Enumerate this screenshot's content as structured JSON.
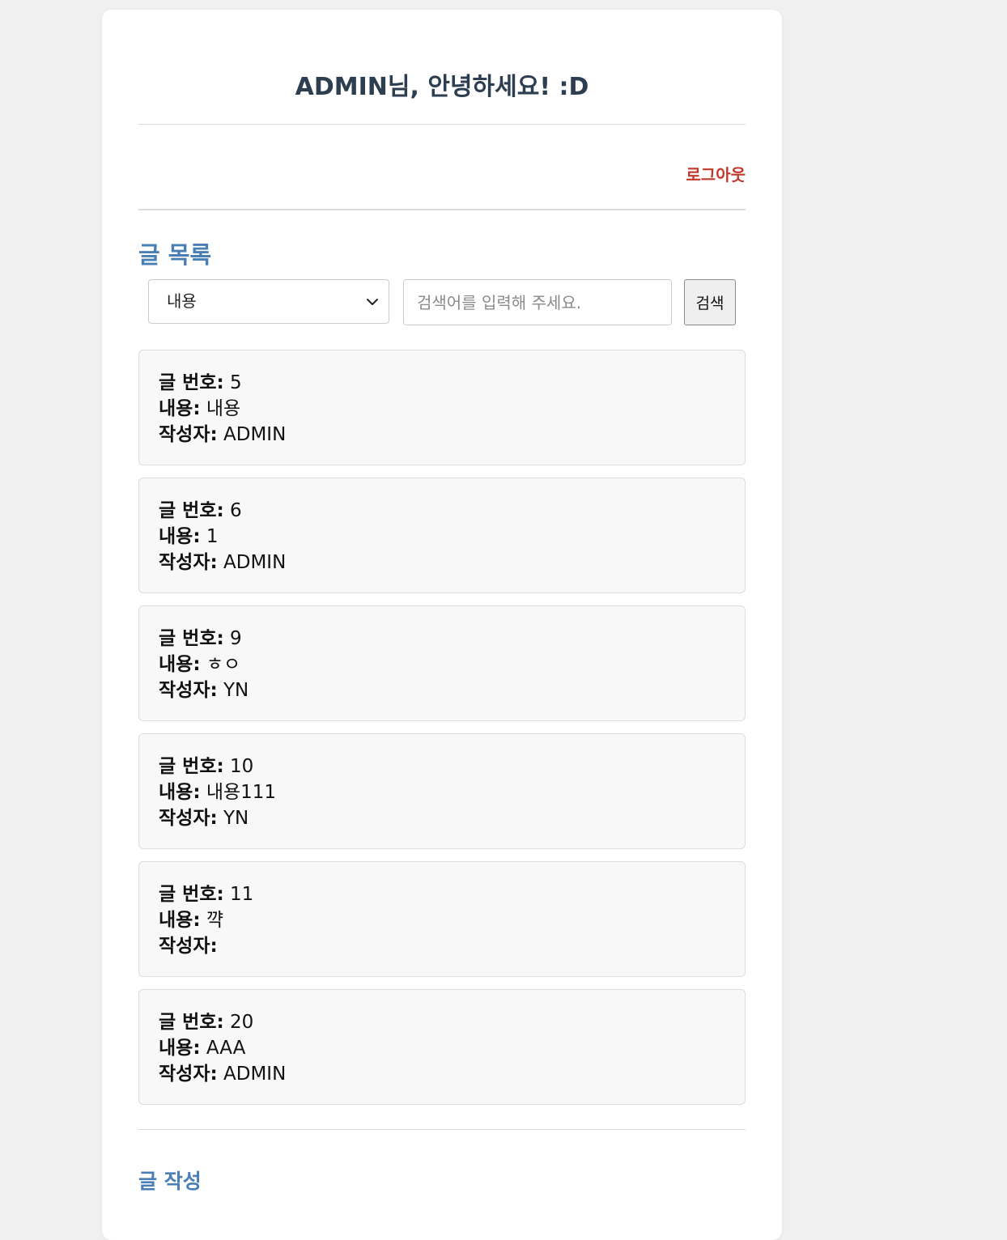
{
  "header": {
    "greeting": "ADMIN님, 안녕하세요! :D",
    "logout_label": "로그아웃"
  },
  "list": {
    "title": "글 목록",
    "search": {
      "selected_option": "내용",
      "placeholder": "검색어를 입력해 주세요.",
      "button_label": "검색"
    },
    "field_labels": {
      "number": "글 번호:",
      "content": "내용:",
      "author": "작성자:"
    },
    "posts": [
      {
        "number": "5",
        "content": "내용",
        "author": "ADMIN"
      },
      {
        "number": "6",
        "content": "1",
        "author": "ADMIN"
      },
      {
        "number": "9",
        "content": "ㅎㅇ",
        "author": "YN"
      },
      {
        "number": "10",
        "content": "내용111",
        "author": "YN"
      },
      {
        "number": "11",
        "content": "꺅",
        "author": ""
      },
      {
        "number": "20",
        "content": "AAA",
        "author": "ADMIN"
      }
    ]
  },
  "footer": {
    "write_label": "글 작성"
  },
  "colors": {
    "heading": "#2c3e50",
    "accent": "#4a7fb5",
    "logout": "#c0392b"
  }
}
